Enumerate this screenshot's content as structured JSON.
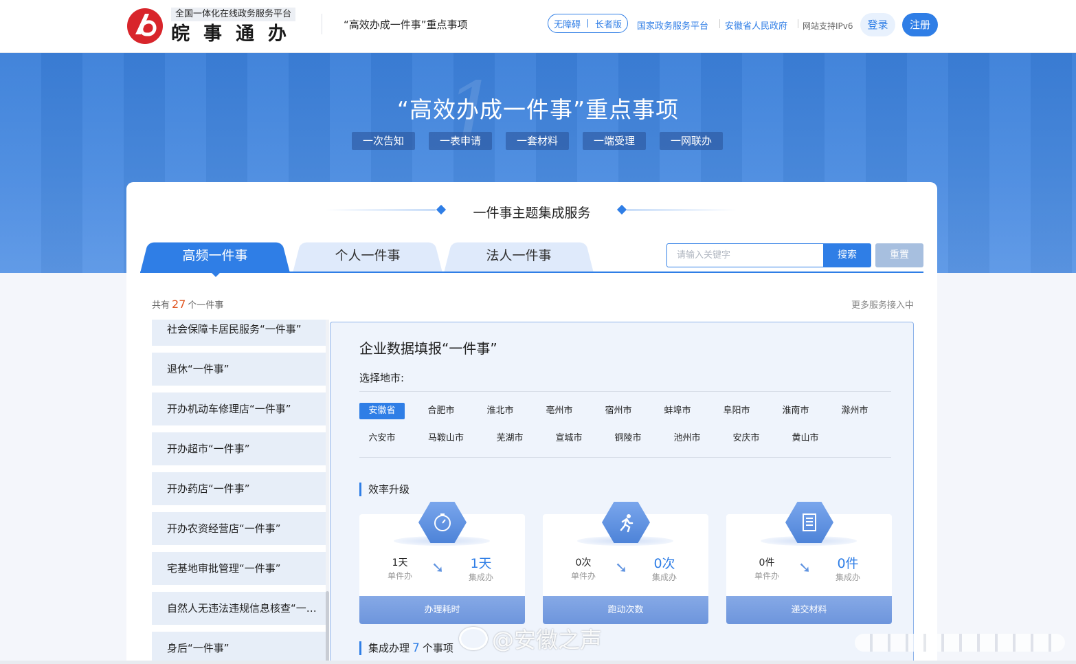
{
  "header": {
    "platform_sub": "全国一体化在线政务服务平台",
    "brand": "皖事通办",
    "page_title": "“高效办成一件事”重点事项",
    "accessibility": "无障碍",
    "elder": "长者版",
    "links": [
      "国家政务服务平台",
      "安徽省人民政府"
    ],
    "ipv6": "网站支持IPv6",
    "login": "登录",
    "register": "注册",
    "brand_color": "#2f7ee6"
  },
  "banner": {
    "bignum": "1",
    "title": "“高效办成一件事”重点事项",
    "tags": [
      "一次告知",
      "一表申请",
      "一套材料",
      "一端受理",
      "一网联办"
    ]
  },
  "section": {
    "title": "一件事主题集成服务",
    "tabs": [
      "高频一件事",
      "个人一件事",
      "法人一件事"
    ],
    "active_tab": 0,
    "search_placeholder": "请输入关键字",
    "search_label": "搜索",
    "reset_label": "重置",
    "count_prefix": "共有",
    "count": "27",
    "count_suffix": "个一件事",
    "more": "更多服务接入中"
  },
  "list": [
    "社会保障卡居民服务“一件事”",
    "退休“一件事”",
    "开办机动车修理店“一件事”",
    "开办超市“一件事”",
    "开办药店“一件事”",
    "开办农资经营店“一件事”",
    "宅基地审批管理“一件事”",
    "自然人无违法违规信息核查“一件事”",
    "身后“一件事”"
  ],
  "detail": {
    "title": "企业数据填报“一件事”",
    "select_label": "选择地市:",
    "cities": [
      "安徽省",
      "合肥市",
      "淮北市",
      "亳州市",
      "宿州市",
      "蚌埠市",
      "阜阳市",
      "淮南市",
      "滁州市",
      "六安市",
      "马鞍山市",
      "芜湖市",
      "宣城市",
      "铜陵市",
      "池州市",
      "安庆市",
      "黄山市"
    ],
    "active_city": 0,
    "efficiency_title": "效率升级",
    "efficiency": [
      {
        "icon": "stopwatch-icon",
        "before": "1天",
        "before_label": "单件办",
        "after": "1天",
        "after_label": "集成办",
        "footer": "办理耗时"
      },
      {
        "icon": "runner-icon",
        "before": "0次",
        "before_label": "单件办",
        "after": "0次",
        "after_label": "集成办",
        "footer": "跑动次数"
      },
      {
        "icon": "document-icon",
        "before": "0件",
        "before_label": "单件办",
        "after": "0件",
        "after_label": "集成办",
        "footer": "递交材料"
      }
    ],
    "integrated_prefix": "集成办理",
    "integrated_count": "7",
    "integrated_suffix": "个事项"
  },
  "watermark": "@安徽之声"
}
